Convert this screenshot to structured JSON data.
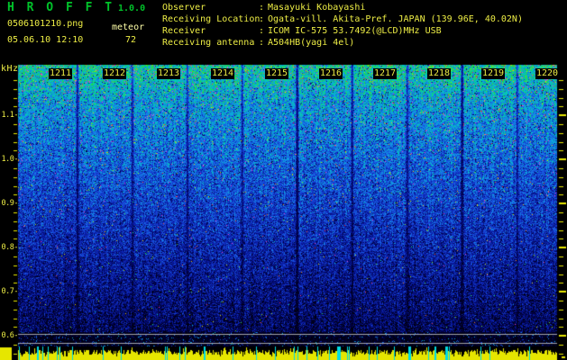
{
  "app": {
    "name": "H R O F F T",
    "version": "1.0.0"
  },
  "capture": {
    "filename": "0506101210.png",
    "mode": "meteor",
    "datetime": "05.06.10 12:10",
    "echo_count": "72"
  },
  "station": {
    "colon": ":",
    "rows": [
      {
        "label": "Observer",
        "value": "Masayuki Kobayashi"
      },
      {
        "label": "Receiving Location",
        "value": "Ogata-vill. Akita-Pref. JAPAN (139.96E, 40.02N)"
      },
      {
        "label": "Receiver",
        "value": "ICOM IC-575 53.7492(@LCD)MHz USB"
      },
      {
        "label": "Receiving antenna",
        "value": "A504HB(yagi 4el)"
      }
    ]
  },
  "spectrogram": {
    "y_axis_unit": "kHz",
    "freq_labels": [
      "1.1-",
      "1.0-",
      "0.9-",
      "0.8-",
      "0.7-",
      "0.6-"
    ],
    "time_labels": [
      "1211",
      "1212",
      "1213",
      "1214",
      "1215",
      "1216",
      "1217",
      "1218",
      "1219",
      "1220"
    ],
    "noise_seed": 1337,
    "colors": {
      "text_yellow": "#EDED45",
      "pale_yellow": "#FFFFA8",
      "title_green": "#00C22A",
      "meter_yellow": "#E6E600",
      "meter_cyan": "#00DCE4",
      "grid_gray": "#C3C3C3",
      "tick_yellow": "#E8E800"
    }
  }
}
